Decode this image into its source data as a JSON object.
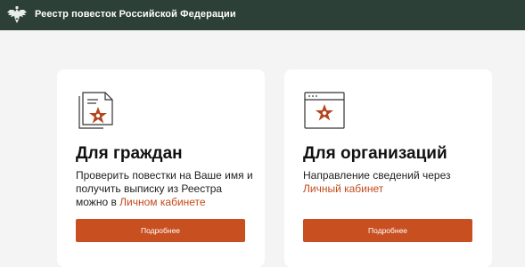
{
  "header": {
    "title": "Реестр повесток Российской Федерации",
    "logo_icon": "double-headed-eagle-emblem-icon"
  },
  "cards": [
    {
      "icon": "document-star-icon",
      "title": "Для граждан",
      "description_part1": "Проверить повестки на Ваше имя и получить выписку из Реестра можно в ",
      "link_label": "Личном кабинете",
      "button_label": "Подробнее"
    },
    {
      "icon": "browser-window-star-icon",
      "title": "Для организаций",
      "description_part1": "Направление сведений через ",
      "link_label": "Личный кабинет",
      "button_label": "Подробнее"
    }
  ],
  "colors": {
    "header_bg": "#2c4038",
    "accent": "#c84f20",
    "page_bg": "#f4f4f4",
    "card_bg": "#ffffff"
  }
}
